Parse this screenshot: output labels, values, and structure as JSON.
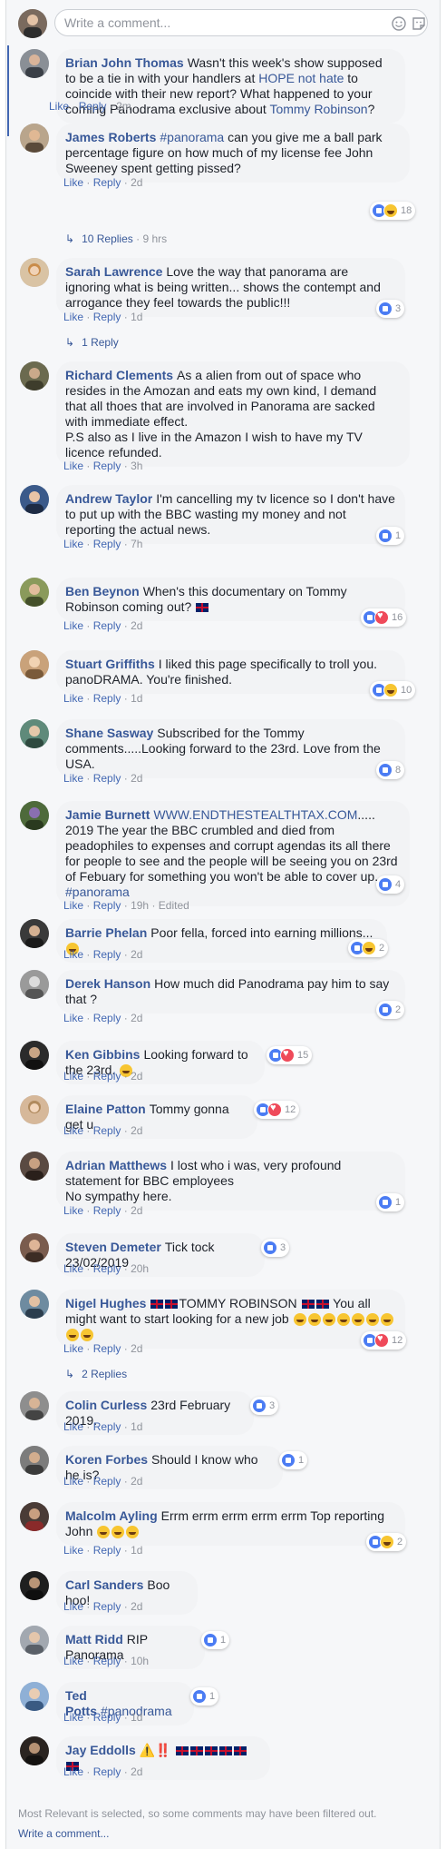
{
  "composer": {
    "placeholder": "Write a comment..."
  },
  "actions": {
    "like": "Like",
    "reply": "Reply",
    "sep": "·"
  },
  "c1": {
    "name": "Brian John Thomas",
    "pre": "Wasn't this week's show supposed to be a tie in with your handlers at ",
    "link1": "HOPE not hate",
    "mid": " to coincide with their new report? What happened to your coming Panodrama exclusive about ",
    "link2": "Tommy Robinson",
    "post": "?",
    "time": "2m"
  },
  "c2": {
    "name": "James Roberts",
    "tag": "#panorama",
    "text": " can you give me a ball park percentage figure on how much of my license fee John Sweeney spent getting pissed?",
    "time": "2d",
    "count": "18",
    "replies": "10 Replies",
    "replies_time": "9 hrs"
  },
  "c3": {
    "name": "Sarah Lawrence",
    "text": "Love the way that panorama are ignoring what is being written... shows the contempt and arrogance they feel towards the public!!!",
    "time": "1d",
    "count": "3",
    "replies": "1 Reply"
  },
  "c4": {
    "name": "Richard Clements",
    "text": "As a alien from out of space who resides in the Amozan and eats my own kind, I demand that all thoes that are involved in Panorama are sacked with immediate effect.",
    "text2": "P.S also as I live in the Amazon I wish to have my TV licence refunded.",
    "time": "3h"
  },
  "c5": {
    "name": "Andrew Taylor",
    "text": "I'm cancelling my tv licence so I don't have to put up with the BBC wasting my money and not reporting the actual news.",
    "time": "7h",
    "count": "1"
  },
  "c6": {
    "name": "Ben Beynon",
    "text": "When's this documentary on Tommy Robinson coming out?",
    "time": "2d",
    "count": "16"
  },
  "c7": {
    "name": "Stuart Griffiths",
    "text": "I liked this page specifically to troll you. panoDRAMA. You're finished.",
    "time": "1d",
    "count": "10"
  },
  "c8": {
    "name": "Shane Sasway",
    "text": "Subscribed for the Tommy comments.....Looking forward to the 23rd. Love from the USA.",
    "time": "2d",
    "count": "8"
  },
  "c9": {
    "name": "Jamie Burnett",
    "link": "WWW.ENDTHESTEALTHTAX.COM",
    "text": "..... 2019 The year the BBC crumbled and died from peadophiles to expenses and corrupt agendas its all there for people to see and the people will be seeing you on 23rd of Febuary for something you won't be able to cover up...... ",
    "tag": "#panorama",
    "time": "19h",
    "edited": "Edited",
    "count": "4"
  },
  "c10": {
    "name": "Barrie Phelan",
    "text": "Poor fella, forced into earning millions...",
    "time": "2d",
    "count": "2"
  },
  "c11": {
    "name": "Derek Hanson",
    "text": "How much did Panodrama pay him to say that ?",
    "time": "2d",
    "count": "2"
  },
  "c12": {
    "name": "Ken Gibbins",
    "text": "Looking forward to the 23rd.",
    "time": "2d",
    "count": "15"
  },
  "c13": {
    "name": "Elaine Patton",
    "text": "Tommy gonna get u",
    "time": "2d",
    "count": "12"
  },
  "c14": {
    "name": "Adrian Matthews",
    "text": "I lost who i was, very profound statement for BBC employees",
    "text2": "No sympathy here.",
    "time": "2d",
    "count": "1"
  },
  "c15": {
    "name": "Steven Demeter",
    "text": "Tick tock 23/02/2019",
    "time": "20h",
    "count": "3"
  },
  "c16": {
    "name": "Nigel Hughes",
    "text": "TOMMY ROBINSON",
    "text2": "You all might want to start looking for a new job",
    "time": "2d",
    "count": "12",
    "replies": "2 Replies"
  },
  "c17": {
    "name": "Colin Curless",
    "text": "23rd February 2019.",
    "time": "1d",
    "count": "3"
  },
  "c18": {
    "name": "Koren Forbes",
    "text": "Should I know who he is?",
    "time": "2d",
    "count": "1"
  },
  "c19": {
    "name": "Malcolm Ayling",
    "text": "Errm errm errm errm errm Top reporting John",
    "time": "1d",
    "count": "2"
  },
  "c20": {
    "name": "Carl Sanders",
    "text": "Boo hoo!",
    "time": "2d"
  },
  "c21": {
    "name": "Matt Ridd",
    "text": "RIP Panorama",
    "time": "10h",
    "count": "1"
  },
  "c22": {
    "name": "Ted Potts",
    "tag": "#panodrama",
    "time": "1d",
    "count": "1"
  },
  "c23": {
    "name": "Jay Eddolls",
    "text": "⚠️‼️",
    "time": "2d"
  },
  "footer": {
    "note": "Most Relevant is selected, so some comments may have been filtered out.",
    "write": "Write a comment..."
  },
  "colors": {
    "link": "#385898",
    "like_blue": "#4b7cf3",
    "bubble": "#f2f3f5",
    "meta": "#90949c"
  }
}
